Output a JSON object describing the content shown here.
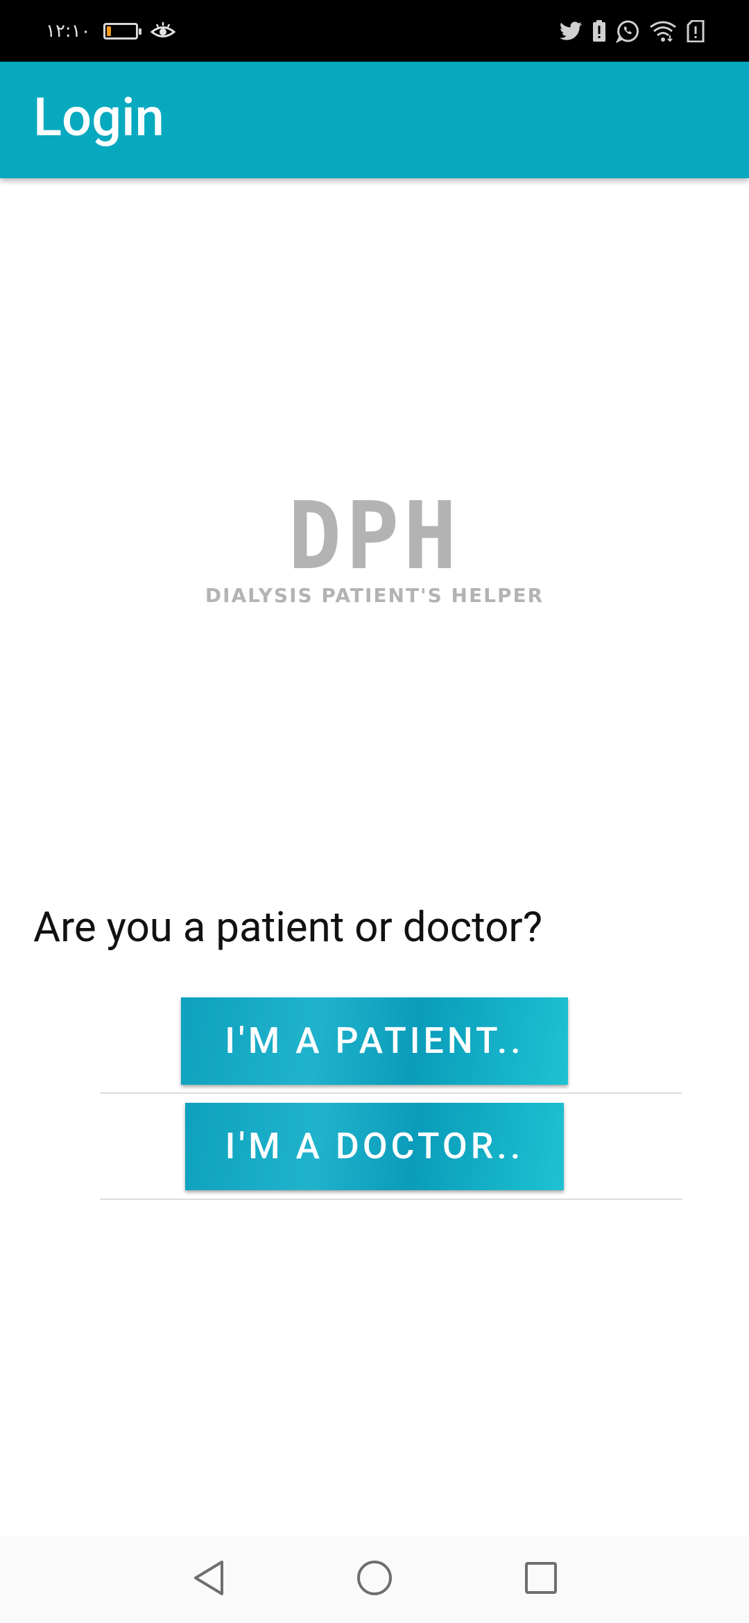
{
  "status_bar": {
    "time": "١٢:١٠",
    "battery_level": 0.15,
    "colors": {
      "battery_low": "#f29a1f"
    },
    "icons": [
      "eye-icon",
      "twitter-icon",
      "battery-alert-icon",
      "whatsapp-icon",
      "wifi-icon",
      "sim-alert-icon"
    ]
  },
  "app_bar": {
    "title": "Login",
    "background": "#07a9bf"
  },
  "logo": {
    "mark": "DPH",
    "subtitle": "DIALYSIS PATIENT'S HELPER"
  },
  "prompt": {
    "question": "Are you a patient or doctor?"
  },
  "buttons": {
    "patient_label": "I'M A PATIENT..",
    "doctor_label": "I'M A DOCTOR.."
  },
  "nav_bar": {
    "icons": [
      "back-icon",
      "home-icon",
      "recents-icon"
    ]
  }
}
